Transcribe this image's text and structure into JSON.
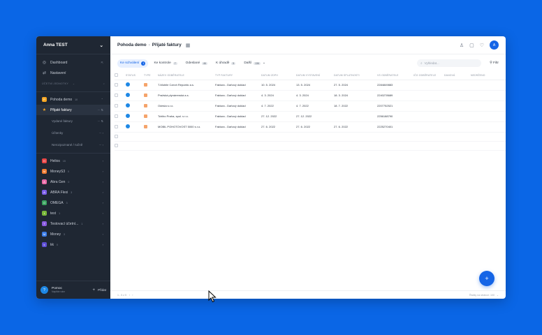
{
  "sidebar": {
    "account": "Anna TEST",
    "nav": [
      {
        "label": "Dashboard",
        "icon": "dashboard-icon"
      },
      {
        "label": "Nastavení",
        "icon": "swap-icon"
      }
    ],
    "section_label": "ÚČETNÍ JEDNOTKY",
    "units": [
      {
        "label": "Pohoda demo",
        "color": "#f5a623",
        "count": "10",
        "expanded": true
      },
      {
        "label": "Helios",
        "color": "#e84545",
        "count": "15"
      },
      {
        "label": "MoneyS3",
        "color": "#f27a2e",
        "count": "0"
      },
      {
        "label": "Abra Gen",
        "color": "#e86aa6",
        "count": "0"
      },
      {
        "label": "ABRA Flexi",
        "color": "#7b5de8",
        "count": "3"
      },
      {
        "label": "OMEGA",
        "color": "#39a35f",
        "count": "3"
      },
      {
        "label": "test",
        "color": "#7ab83a",
        "count": "1"
      },
      {
        "label": "Testovací účetní...",
        "color": "#8a5be0",
        "count": "1"
      },
      {
        "label": "Money",
        "color": "#3b7de8",
        "count": "3"
      },
      {
        "label": "kk",
        "color": "#5e4fd6",
        "count": "0"
      }
    ],
    "subitems": [
      {
        "label": "Přijaté faktury",
        "active": true
      },
      {
        "label": "Vydané faktury"
      },
      {
        "label": "Účtenky"
      },
      {
        "label": "Nerozpoznané / ručně"
      }
    ],
    "footer": {
      "title": "Pomoc",
      "subtitle": "Napište nám",
      "login": "Přidat"
    }
  },
  "header": {
    "crumb_parent": "Pohoda demo",
    "crumb_current": "Přijaté faktury"
  },
  "filters": [
    {
      "label": "Ke schválení",
      "count": "1",
      "active": true
    },
    {
      "label": "Ke kontrole",
      "count": "7"
    },
    {
      "label": "Odeslané",
      "count": "46"
    },
    {
      "label": "K úhradě",
      "count": "5"
    },
    {
      "label": "Další",
      "count": "136"
    }
  ],
  "search": {
    "placeholder": "Vyhledat..."
  },
  "filter_button": "Filtr",
  "table": {
    "columns": [
      "STATUS",
      "TYPE",
      "NÁZEV ODBĚRATELE",
      "TYP FAKTURY",
      "DATUM ZDPH",
      "DATUM VYSTAVENÍ",
      "DATUM SPLATNOSTI",
      "VS ODBĚRATELE",
      "IČO ODBĚRATELE",
      "DANOVÁ",
      "NEDRŽENO"
    ],
    "rows": [
      {
        "name": "T-Mobile Czech Republic a.s.",
        "type": "Faktura - Daňový doklad",
        "zdph": "10. 5. 2024",
        "vyst": "13. 5. 2024",
        "splat": "27. 5. 2024",
        "vs": "2284849883"
      },
      {
        "name": "Pražská plynárenská a.s.",
        "type": "Faktura - Daňový doklad",
        "zdph": "4. 3. 2024",
        "vyst": "4. 3. 2024",
        "splat": "18. 3. 2024",
        "vs": "2240278689"
      },
      {
        "name": "Odesla s.r.o.",
        "type": "Faktura - Daňový doklad",
        "zdph": "4. 7. 2022",
        "vyst": "4. 7. 2022",
        "splat": "18. 7. 2022",
        "vs": "2207752521"
      },
      {
        "name": "Tchibo Praha, spol. s r.o.",
        "type": "Faktura - Daňový doklad",
        "zdph": "27. 12. 2022",
        "vyst": "27. 12. 2022",
        "splat": "",
        "vs": "2256188790"
      },
      {
        "name": "MOBIL POHOTOVOST 5000 s.r.o.",
        "type": "Faktura - Daňový doklad",
        "zdph": "27. 6. 2022",
        "vyst": "27. 6. 2022",
        "splat": "27. 6. 2022",
        "vs": "2225270401"
      }
    ]
  },
  "pagination": {
    "range": "1 - 5 z 5",
    "rows_per_page": "Řádky na stránce: 100"
  },
  "colors": {
    "accent": "#1565e6",
    "sidebar": "#1f2733",
    "background": "#0a66e6"
  }
}
